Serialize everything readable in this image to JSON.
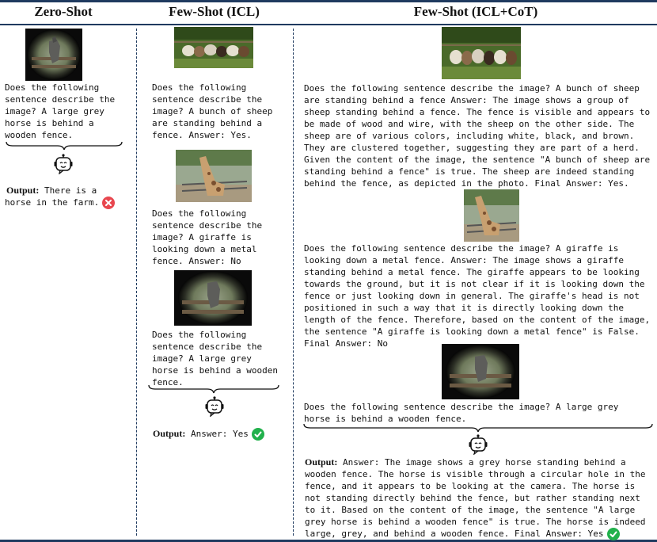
{
  "headers": {
    "zero_shot": "Zero-Shot",
    "few_shot_icl": "Few-Shot (ICL)",
    "few_shot_icl_cot": "Few-Shot (ICL+CoT)"
  },
  "zero_shot": {
    "question": "Does the following\nsentence describe the\nimage? A large grey\nhorse is behind a\nwooden fence.",
    "output_label": "Output:",
    "output_text_1": "There is a",
    "output_text_2": "horse in the farm.",
    "result": "incorrect"
  },
  "icl": {
    "example1": "Does the following\nsentence describe the\nimage? A bunch of sheep\nare standing behind a\nfence. Answer: Yes.",
    "example2": "Does the following\nsentence describe the\nimage? A giraffe is\nlooking down a metal\nfence. Answer: No",
    "query": "Does the following\nsentence describe the\nimage? A large grey\nhorse is behind a wooden\nfence.",
    "output_label": "Output:",
    "output_text": "Answer: Yes",
    "result": "correct"
  },
  "cot": {
    "example1": "Does the following sentence describe the image? A bunch of sheep\nare standing behind a fence Answer: The image shows a group of\nsheep standing behind a fence. The fence is visible and appears to\nbe made of wood and wire, with the sheep on the other side. The\nsheep are of various colors, including white, black, and brown.\nThey are clustered together, suggesting they are part of a herd.\nGiven the content of the image, the sentence \"A bunch of sheep are\nstanding behind a fence\" is true. The sheep are indeed standing\nbehind the fence, as depicted in the photo. Final Answer: Yes.",
    "example2": "Does the following sentence describe the image? A giraffe is\nlooking down a metal fence. Answer: The image shows a giraffe\nstanding behind a metal fence. The giraffe appears to be looking\ntowards the ground, but it is not clear if it is looking down the\nfence or just looking down in general. The giraffe's head is not\npositioned in such a way that it is directly looking down the\nlength of the fence. Therefore, based on the content of the image,\nthe sentence \"A giraffe is looking down a metal fence\" is False.\nFinal Answer: No",
    "query": "Does the following sentence describe the image? A large grey\nhorse is behind a wooden fence.",
    "output_label": "Output:",
    "output_text": "Answer: The image shows a grey horse standing behind a\nwooden fence. The horse is visible through a circular hole in the\nfence, and it appears to be looking at the camera. The horse is\nnot standing directly behind the fence, but rather standing next\nto it. Based on the content of the image, the sentence \"A large\ngrey horse is behind a wooden fence\" is true. The horse is indeed\nlarge, grey, and behind a wooden fence. Final Answer: Yes",
    "result": "correct"
  },
  "colors": {
    "rule": "#1f3a5f",
    "correct": "#22b14c",
    "incorrect": "#e8474f"
  }
}
